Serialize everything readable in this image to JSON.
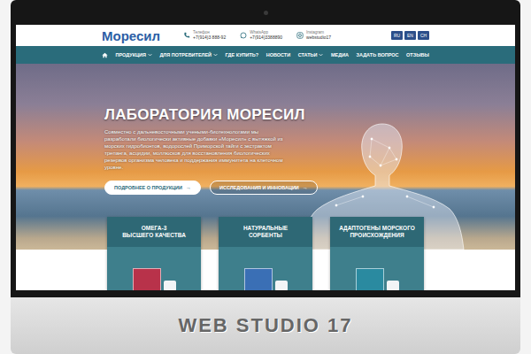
{
  "monitor": {
    "caption": "WEB STUDIO 17"
  },
  "header": {
    "logo": "Моресил",
    "contacts": [
      {
        "kind": "phone",
        "label": "Телефон",
        "value": "+7(914)3 888-92"
      },
      {
        "kind": "whatsapp",
        "label": "WhatsApp",
        "value": "+7(914)3388890"
      },
      {
        "kind": "instagram",
        "label": "Instagram",
        "value": "webstudio17"
      }
    ],
    "languages": [
      "RU",
      "EN",
      "CH"
    ]
  },
  "nav": {
    "items": [
      {
        "label": "ПРОДУКЦИЯ",
        "dropdown": true
      },
      {
        "label": "ДЛЯ ПОТРЕБИТЕЛЕЙ",
        "dropdown": true
      },
      {
        "label": "ГДЕ КУПИТЬ?",
        "dropdown": false
      },
      {
        "label": "НОВОСТИ",
        "dropdown": false
      },
      {
        "label": "СТАТЬИ",
        "dropdown": true
      },
      {
        "label": "МЕДИА",
        "dropdown": false
      },
      {
        "label": "ЗАДАТЬ ВОПРОС",
        "dropdown": false
      },
      {
        "label": "ОТЗЫВЫ",
        "dropdown": false
      }
    ]
  },
  "hero": {
    "title": "ЛАБОРАТОРИЯ МОРЕСИЛ",
    "text": "Совместно с дальневосточными учеными-биотехнологами мы разработали биологически активные добавки «Моресил» с вытяжкой из морских гидробионтов, водорослей Приморской тайги с экстрактом трепанга, асцидии, моллюсков для восстановления биологических резервов организма человека и поддержания иммунитета на клеточном уровне.",
    "buttons": [
      {
        "label": "ПОДРОБНЕЕ О ПРОДУКЦИИ",
        "icon": "→",
        "kind": "filled"
      },
      {
        "label": "ИССЛЕДОВАНИЯ И ИННОВАЦИИ",
        "icon": "→",
        "kind": "outline"
      }
    ]
  },
  "cards": [
    {
      "lines": [
        "ОМЕГА-3",
        "ВЫСШЕГО КАЧЕСТВА"
      ],
      "color": "#b8324a"
    },
    {
      "lines": [
        "НАТУРАЛЬНЫЕ",
        "СОРБЕНТЫ"
      ],
      "color": "#3a6fb5"
    },
    {
      "lines": [
        "АДАПТОГЕНЫ МОРСКОГО",
        "ПРОИСХОЖДЕНИЯ"
      ],
      "color": "#2a8aa0"
    }
  ]
}
